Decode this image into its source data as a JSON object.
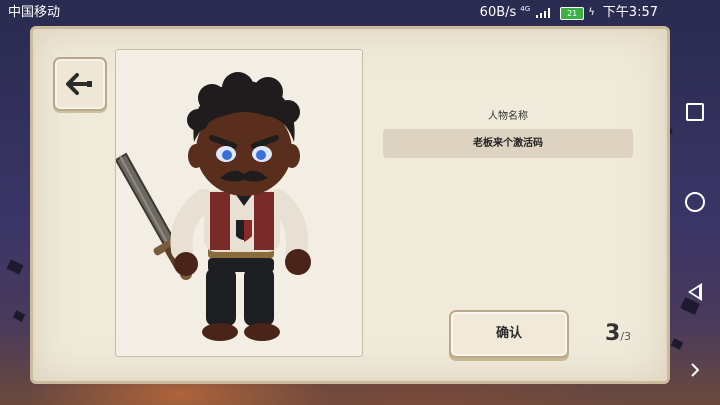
{
  "status_bar": {
    "carrier": "中国移动",
    "net_speed": "60B/s",
    "network": "4G",
    "battery_level": "21",
    "time": "下午3:57"
  },
  "panel": {
    "back_icon": "arrow-left-icon",
    "name_label": "人物名称",
    "name_value": "老板来个激活码",
    "confirm_label": "确认",
    "page_current": "3",
    "page_separator": "/",
    "page_total": "3"
  },
  "system_nav": {
    "icons": [
      "recents-square-icon",
      "home-circle-icon",
      "back-triangle-icon"
    ]
  },
  "colors": {
    "panel_bg": "#f0eadb",
    "panel_border": "#c9bb9b",
    "name_field_bg": "#ddd3c0",
    "background": "#2a2b50"
  }
}
